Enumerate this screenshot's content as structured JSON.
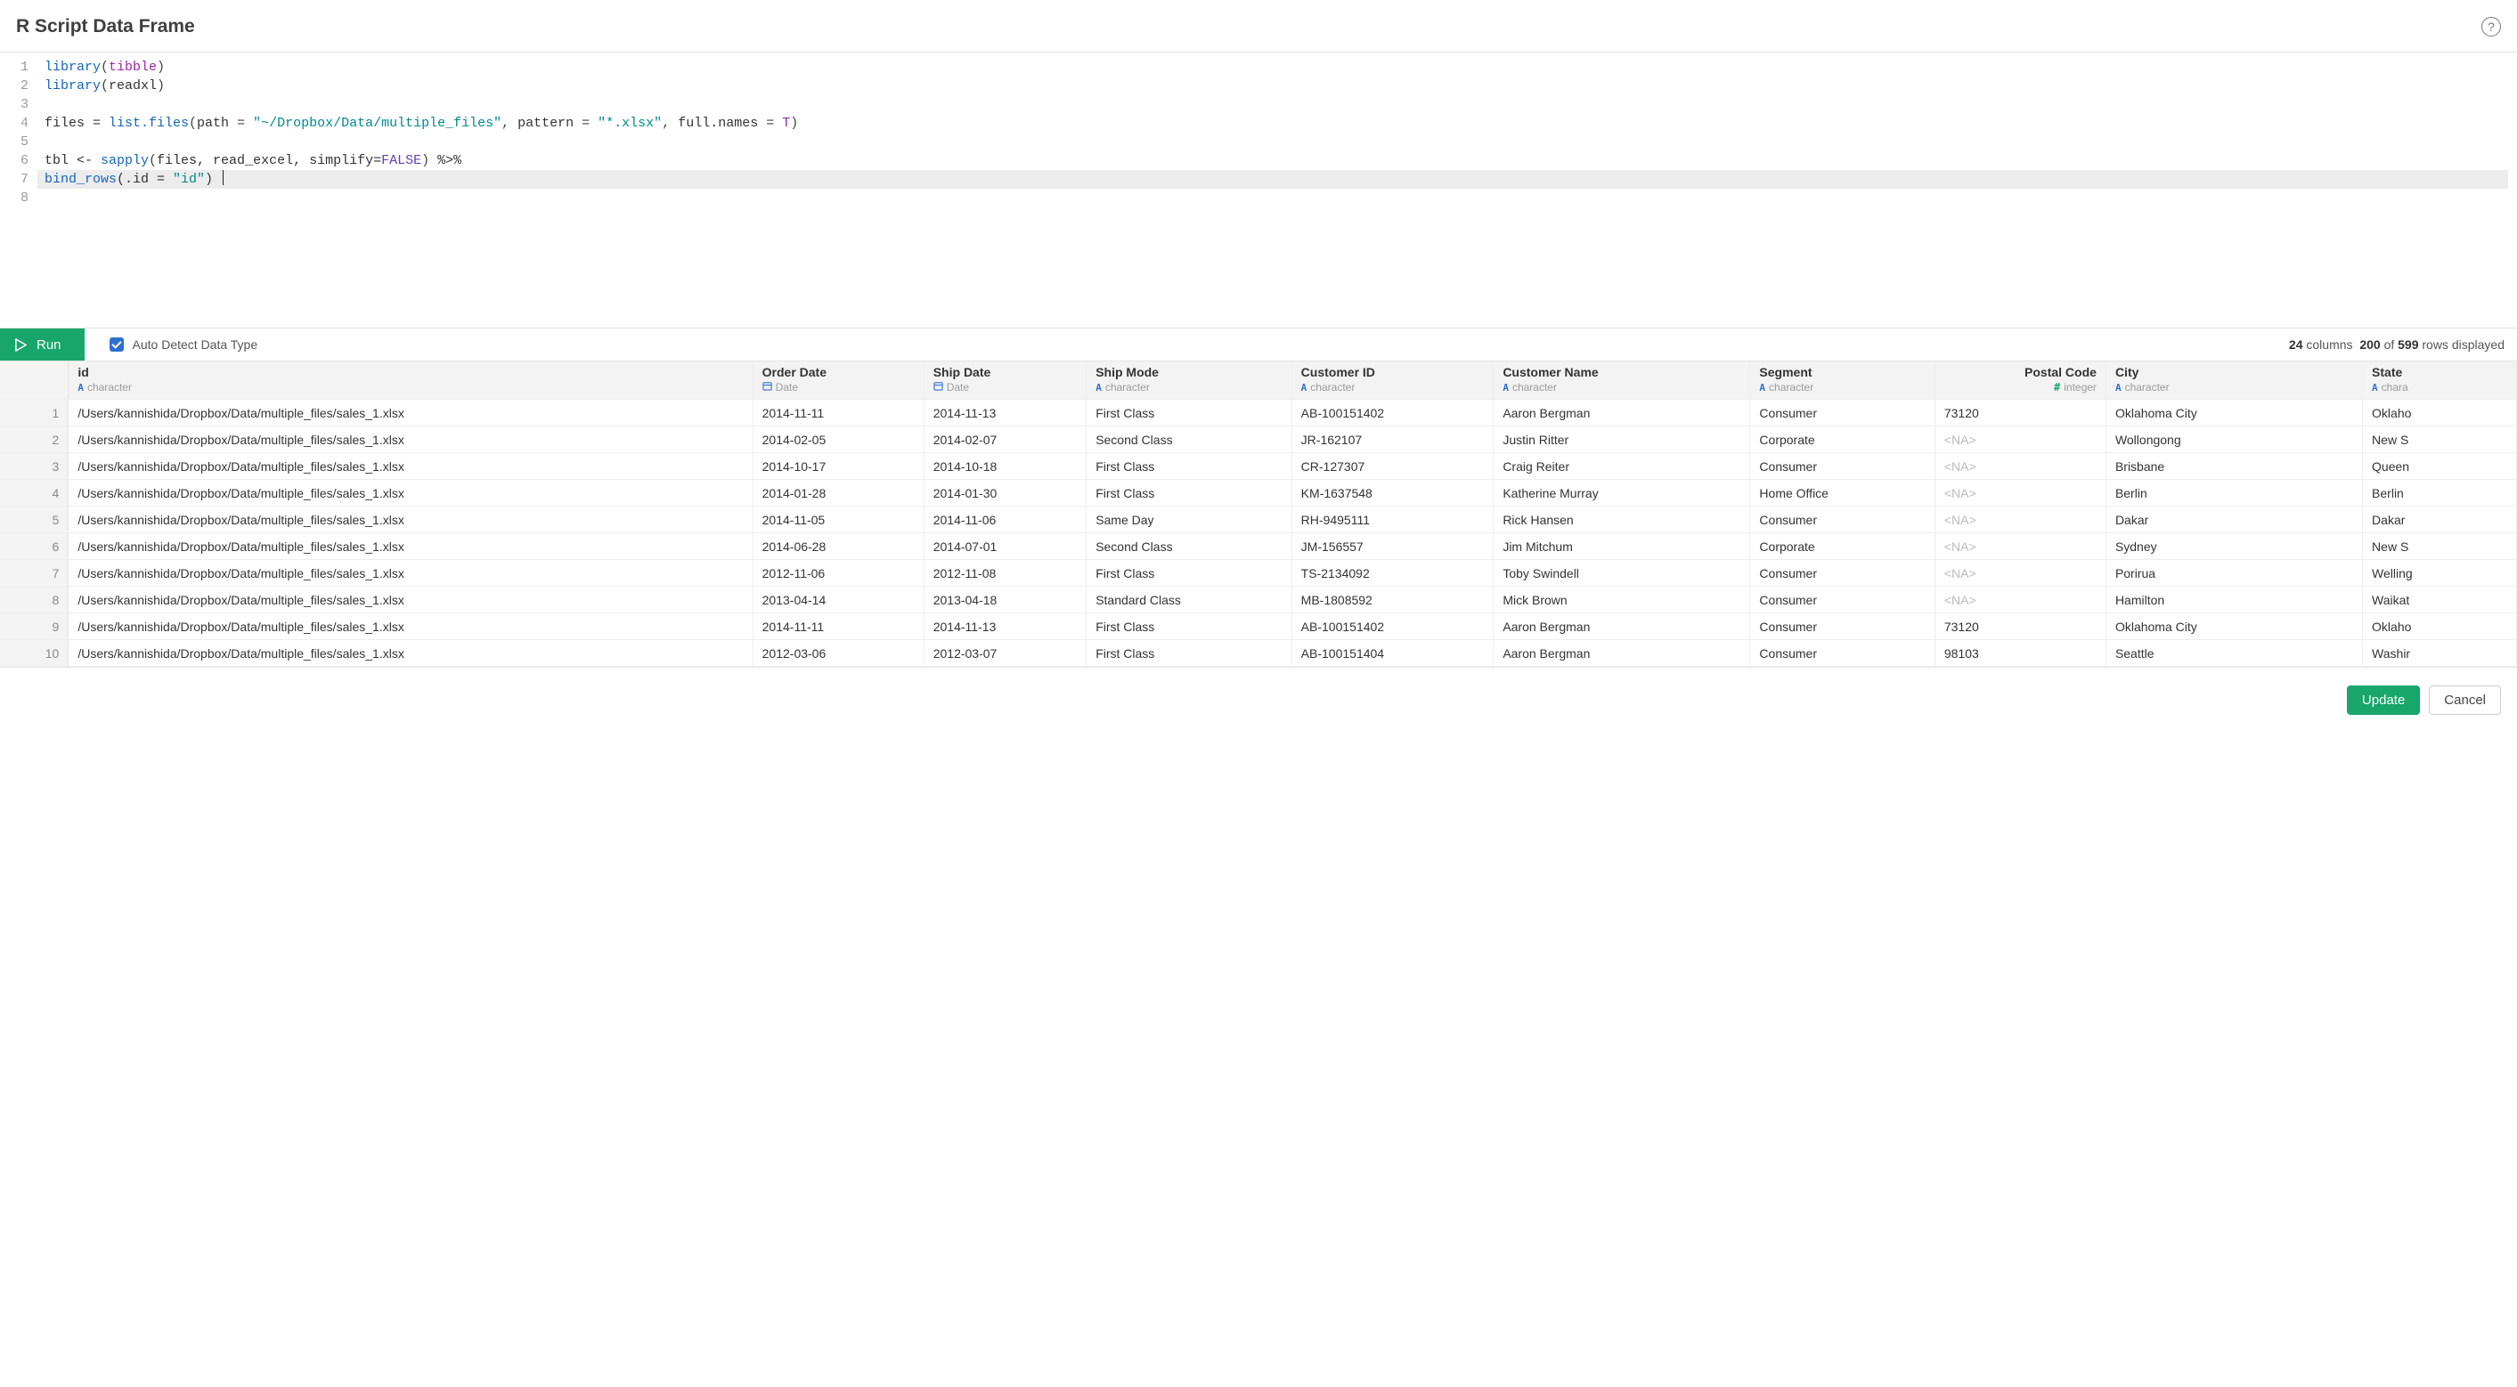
{
  "header": {
    "title": "R Script Data Frame"
  },
  "help_label": "?",
  "code": {
    "lines": [
      {
        "n": 1,
        "tokens": [
          {
            "t": "library",
            "c": "tok-key"
          },
          {
            "t": "(",
            "c": "tok-punc"
          },
          {
            "t": "tibble",
            "c": "tok-ident"
          },
          {
            "t": ")",
            "c": "tok-punc"
          }
        ]
      },
      {
        "n": 2,
        "tokens": [
          {
            "t": "library",
            "c": "tok-key"
          },
          {
            "t": "(",
            "c": "tok-punc"
          },
          {
            "t": "readxl",
            "c": "tok-plain"
          },
          {
            "t": ")",
            "c": "tok-punc"
          }
        ]
      },
      {
        "n": 3,
        "tokens": []
      },
      {
        "n": 4,
        "tokens": [
          {
            "t": "files = ",
            "c": "tok-plain"
          },
          {
            "t": "list.files",
            "c": "tok-key"
          },
          {
            "t": "(",
            "c": "tok-punc"
          },
          {
            "t": "path",
            "c": "tok-plain"
          },
          {
            "t": " = ",
            "c": "tok-punc"
          },
          {
            "t": "\"~/Dropbox/Data/multiple_files\"",
            "c": "tok-str"
          },
          {
            "t": ", ",
            "c": "tok-punc"
          },
          {
            "t": "pattern",
            "c": "tok-plain"
          },
          {
            "t": " = ",
            "c": "tok-punc"
          },
          {
            "t": "\"*.xlsx\"",
            "c": "tok-str"
          },
          {
            "t": ", ",
            "c": "tok-punc"
          },
          {
            "t": "full.names",
            "c": "tok-plain"
          },
          {
            "t": " = ",
            "c": "tok-punc"
          },
          {
            "t": "T",
            "c": "tok-ident"
          },
          {
            "t": ")",
            "c": "tok-punc"
          }
        ]
      },
      {
        "n": 5,
        "tokens": []
      },
      {
        "n": 6,
        "tokens": [
          {
            "t": "tbl <- ",
            "c": "tok-plain"
          },
          {
            "t": "sapply",
            "c": "tok-key"
          },
          {
            "t": "(",
            "c": "tok-punc"
          },
          {
            "t": "files, read_excel, simplify=",
            "c": "tok-plain"
          },
          {
            "t": "FALSE",
            "c": "tok-false"
          },
          {
            "t": ")",
            "c": "tok-punc"
          },
          {
            "t": " %>%",
            "c": "tok-plain"
          }
        ]
      },
      {
        "n": 7,
        "current": true,
        "cursor": true,
        "tokens": [
          {
            "t": "bind_rows",
            "c": "tok-key"
          },
          {
            "t": "(.id = ",
            "c": "tok-plain"
          },
          {
            "t": "\"id\"",
            "c": "tok-str"
          },
          {
            "t": ") ",
            "c": "tok-plain"
          }
        ]
      },
      {
        "n": 8,
        "tokens": []
      }
    ]
  },
  "toolbar": {
    "run_label": "Run",
    "auto_detect_label": "Auto Detect Data Type",
    "auto_detect_checked": true,
    "status_columns": "24",
    "status_columns_label": "columns",
    "status_shown": "200",
    "status_of": "of",
    "status_total": "599",
    "status_tail": "rows displayed"
  },
  "table": {
    "columns": [
      {
        "name": "id",
        "type": "character",
        "icon": "A"
      },
      {
        "name": "Order Date",
        "type": "Date",
        "icon": "cal"
      },
      {
        "name": "Ship Date",
        "type": "Date",
        "icon": "cal"
      },
      {
        "name": "Ship Mode",
        "type": "character",
        "icon": "A"
      },
      {
        "name": "Customer ID",
        "type": "character",
        "icon": "A"
      },
      {
        "name": "Customer Name",
        "type": "character",
        "icon": "A"
      },
      {
        "name": "Segment",
        "type": "character",
        "icon": "A"
      },
      {
        "name": "Postal Code",
        "type": "integer",
        "icon": "#",
        "align": "right"
      },
      {
        "name": "City",
        "type": "character",
        "icon": "A"
      },
      {
        "name": "State",
        "type": "chara",
        "icon": "A"
      }
    ],
    "rows": [
      {
        "n": 1,
        "cells": [
          "/Users/kannishida/Dropbox/Data/multiple_files/sales_1.xlsx",
          "2014-11-11",
          "2014-11-13",
          "First Class",
          "AB-100151402",
          "Aaron Bergman",
          "Consumer",
          "73120",
          "Oklahoma City",
          "Oklaho"
        ]
      },
      {
        "n": 2,
        "cells": [
          "/Users/kannishida/Dropbox/Data/multiple_files/sales_1.xlsx",
          "2014-02-05",
          "2014-02-07",
          "Second Class",
          "JR-162107",
          "Justin Ritter",
          "Corporate",
          "<NA>",
          "Wollongong",
          "New S"
        ]
      },
      {
        "n": 3,
        "cells": [
          "/Users/kannishida/Dropbox/Data/multiple_files/sales_1.xlsx",
          "2014-10-17",
          "2014-10-18",
          "First Class",
          "CR-127307",
          "Craig Reiter",
          "Consumer",
          "<NA>",
          "Brisbane",
          "Queen"
        ]
      },
      {
        "n": 4,
        "cells": [
          "/Users/kannishida/Dropbox/Data/multiple_files/sales_1.xlsx",
          "2014-01-28",
          "2014-01-30",
          "First Class",
          "KM-1637548",
          "Katherine Murray",
          "Home Office",
          "<NA>",
          "Berlin",
          "Berlin"
        ]
      },
      {
        "n": 5,
        "cells": [
          "/Users/kannishida/Dropbox/Data/multiple_files/sales_1.xlsx",
          "2014-11-05",
          "2014-11-06",
          "Same Day",
          "RH-9495111",
          "Rick Hansen",
          "Consumer",
          "<NA>",
          "Dakar",
          "Dakar"
        ]
      },
      {
        "n": 6,
        "cells": [
          "/Users/kannishida/Dropbox/Data/multiple_files/sales_1.xlsx",
          "2014-06-28",
          "2014-07-01",
          "Second Class",
          "JM-156557",
          "Jim Mitchum",
          "Corporate",
          "<NA>",
          "Sydney",
          "New S"
        ]
      },
      {
        "n": 7,
        "cells": [
          "/Users/kannishida/Dropbox/Data/multiple_files/sales_1.xlsx",
          "2012-11-06",
          "2012-11-08",
          "First Class",
          "TS-2134092",
          "Toby Swindell",
          "Consumer",
          "<NA>",
          "Porirua",
          "Welling"
        ]
      },
      {
        "n": 8,
        "cells": [
          "/Users/kannishida/Dropbox/Data/multiple_files/sales_1.xlsx",
          "2013-04-14",
          "2013-04-18",
          "Standard Class",
          "MB-1808592",
          "Mick Brown",
          "Consumer",
          "<NA>",
          "Hamilton",
          "Waikat"
        ]
      },
      {
        "n": 9,
        "cells": [
          "/Users/kannishida/Dropbox/Data/multiple_files/sales_1.xlsx",
          "2014-11-11",
          "2014-11-13",
          "First Class",
          "AB-100151402",
          "Aaron Bergman",
          "Consumer",
          "73120",
          "Oklahoma City",
          "Oklaho"
        ]
      },
      {
        "n": 10,
        "cells": [
          "/Users/kannishida/Dropbox/Data/multiple_files/sales_1.xlsx",
          "2012-03-06",
          "2012-03-07",
          "First Class",
          "AB-100151404",
          "Aaron Bergman",
          "Consumer",
          "98103",
          "Seattle",
          "Washir"
        ]
      }
    ],
    "postal_index": 7,
    "na_token": "<NA>"
  },
  "footer": {
    "update_label": "Update",
    "cancel_label": "Cancel"
  }
}
